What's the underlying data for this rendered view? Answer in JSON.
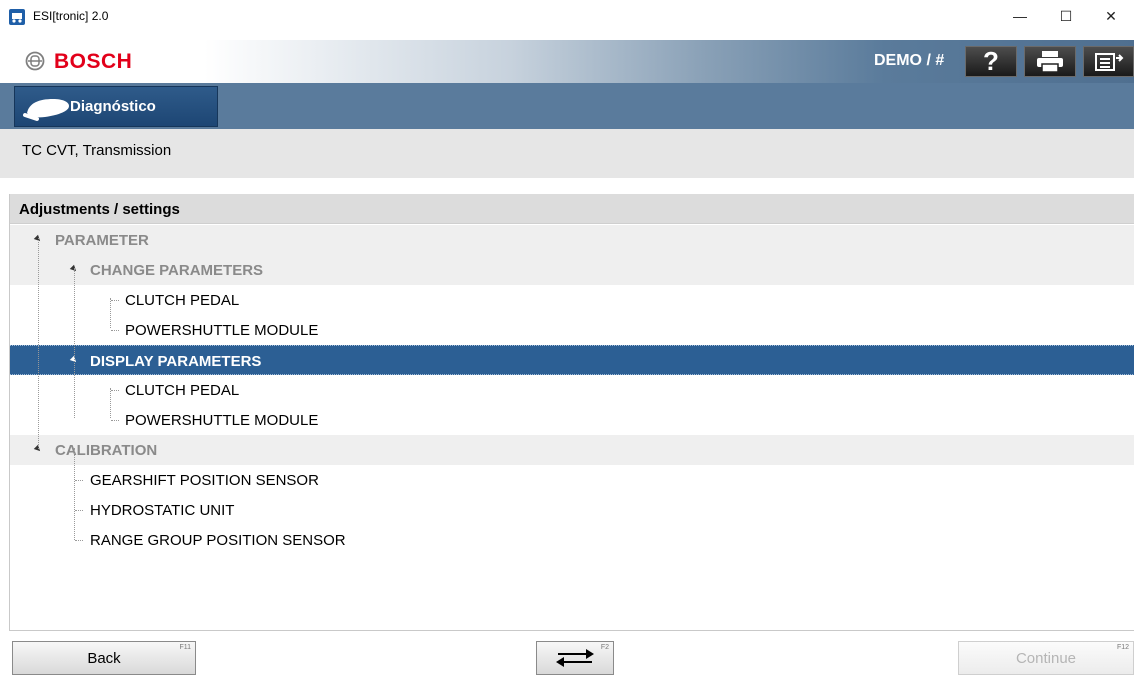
{
  "window": {
    "title": "ESI[tronic] 2.0",
    "minimize_glyph": "—",
    "maximize_glyph": "☐",
    "close_glyph": "✕"
  },
  "header": {
    "brand": "BOSCH",
    "demo_label": "DEMO / #",
    "buttons": [
      {
        "icon": "help-icon",
        "glyph": "?"
      },
      {
        "icon": "print-icon"
      },
      {
        "icon": "menu-export-icon"
      }
    ]
  },
  "tab": {
    "label": "Diagnóstico",
    "icon": "car-icon"
  },
  "breadcrumb": "TC CVT, Transmission",
  "panel": {
    "title": "Adjustments / settings",
    "tree": [
      {
        "label": "PARAMETER",
        "level": 0,
        "kind": "category"
      },
      {
        "label": "CHANGE PARAMETERS",
        "level": 1,
        "kind": "category"
      },
      {
        "label": "CLUTCH PEDAL",
        "level": 2,
        "kind": "item"
      },
      {
        "label": "POWERSHUTTLE MODULE",
        "level": 2,
        "kind": "item"
      },
      {
        "label": "DISPLAY PARAMETERS",
        "level": 1,
        "kind": "category",
        "selected": true
      },
      {
        "label": "CLUTCH PEDAL",
        "level": 2,
        "kind": "item"
      },
      {
        "label": "POWERSHUTTLE MODULE",
        "level": 2,
        "kind": "item"
      },
      {
        "label": "CALIBRATION",
        "level": 0,
        "kind": "category"
      },
      {
        "label": "GEARSHIFT POSITION SENSOR",
        "level": 1,
        "kind": "item"
      },
      {
        "label": "HYDROSTATIC UNIT",
        "level": 1,
        "kind": "item"
      },
      {
        "label": "RANGE GROUP POSITION SENSOR",
        "level": 1,
        "kind": "item"
      }
    ]
  },
  "footer": {
    "back": {
      "label": "Back",
      "key": "F11"
    },
    "switch": {
      "key": "F2",
      "icon": "swap-arrows-icon"
    },
    "continue": {
      "label": "Continue",
      "key": "F12",
      "enabled": false
    }
  },
  "colors": {
    "selection": "#2c5f94",
    "brand_red": "#e2001a",
    "tab_blue": "#2f5b8a",
    "header_blue": "#5a7b9c"
  }
}
